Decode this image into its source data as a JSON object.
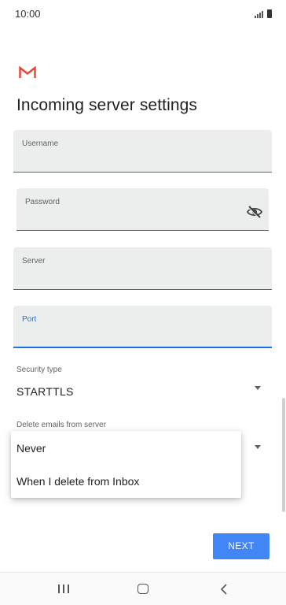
{
  "status_bar": {
    "time": "10:00",
    "icons": [
      "signal-icon",
      "battery-icon"
    ]
  },
  "header": {
    "logo": "gmail-logo",
    "title": "Incoming server settings"
  },
  "form": {
    "username": {
      "label": "Username",
      "value": ""
    },
    "password": {
      "label": "Password",
      "value": "",
      "toggle_icon": "eye-off-icon"
    },
    "server": {
      "label": "Server",
      "value": ""
    },
    "port": {
      "label": "Port",
      "value": ""
    },
    "security_type": {
      "label": "Security type",
      "value": "STARTTLS"
    },
    "delete_emails": {
      "label": "Delete emails from server",
      "options": [
        "Never",
        "When I delete from Inbox"
      ]
    }
  },
  "actions": {
    "next_label": "NEXT"
  },
  "nav_bar": {
    "buttons": [
      "recent-apps-icon",
      "home-icon",
      "back-icon"
    ]
  },
  "colors": {
    "accent": "#1a73e8",
    "button": "#4285f4",
    "field_bg": "#eceeee",
    "gmail_red": "#ea4335"
  }
}
